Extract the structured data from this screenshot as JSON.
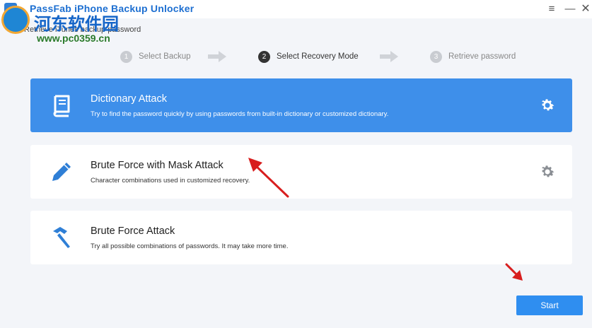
{
  "app": {
    "title": "PassFab iPhone Backup Unlocker",
    "subtitle": "Retrieve iTunes backup password"
  },
  "watermark": {
    "text": "河东软件园",
    "url": "www.pc0359.cn"
  },
  "window_controls": {
    "menu": "≡",
    "minimize": "—",
    "close": "✕"
  },
  "steps": [
    {
      "number": "1",
      "label": "Select Backup",
      "active": false
    },
    {
      "number": "2",
      "label": "Select Recovery Mode",
      "active": true
    },
    {
      "number": "3",
      "label": "Retrieve password",
      "active": false
    }
  ],
  "modes": [
    {
      "title": "Dictionary Attack",
      "description": "Try to find the password quickly by using passwords from built-in dictionary or customized dictionary.",
      "icon": "book-icon",
      "selected": true,
      "has_settings": true
    },
    {
      "title": "Brute Force with Mask Attack",
      "description": "Character combinations used in customized recovery.",
      "icon": "pencil-icon",
      "selected": false,
      "has_settings": true
    },
    {
      "title": "Brute Force Attack",
      "description": "Try all possible combinations of passwords. It may take more time.",
      "icon": "hammer-icon",
      "selected": false,
      "has_settings": false
    }
  ],
  "start_button": {
    "label": "Start"
  },
  "colors": {
    "accent": "#3e8fea",
    "button": "#2f8ef0",
    "background": "#f3f5f9",
    "annotation_arrow": "#d81e1e"
  }
}
